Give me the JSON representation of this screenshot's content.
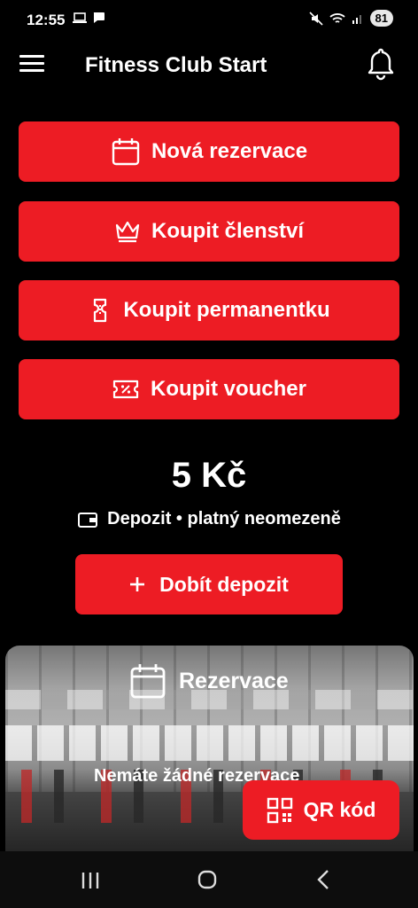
{
  "status_bar": {
    "time": "12:55",
    "battery": "81"
  },
  "app_bar": {
    "title": "Fitness Club Start"
  },
  "actions": [
    {
      "label": "Nová rezervace",
      "icon": "calendar-icon"
    },
    {
      "label": "Koupit členství",
      "icon": "crown-icon"
    },
    {
      "label": "Koupit permanentku",
      "icon": "ticket-icon"
    },
    {
      "label": "Koupit voucher",
      "icon": "voucher-icon"
    }
  ],
  "deposit": {
    "amount": "5 Kč",
    "info": "Depozit • platný neomezeně",
    "topup_label": "Dobít depozit"
  },
  "reservations": {
    "title": "Rezervace",
    "empty_text": "Nemáte žádné rezervace"
  },
  "qr_button": {
    "label": "QR kód"
  },
  "colors": {
    "accent": "#ed1c24",
    "background": "#000000"
  }
}
